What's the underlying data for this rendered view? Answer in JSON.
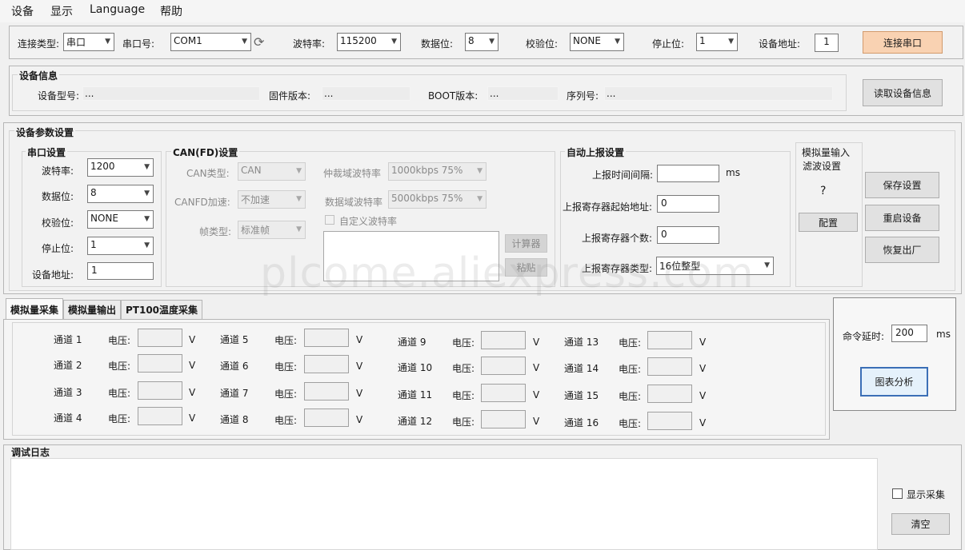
{
  "menu": [
    "设备",
    "显示",
    "Language",
    "帮助"
  ],
  "connection": {
    "type_label": "连接类型:",
    "type_value": "串口",
    "port_label": "串口号:",
    "port_value": "COM1",
    "baud_label": "波特率:",
    "baud_value": "115200",
    "databits_label": "数据位:",
    "databits_value": "8",
    "parity_label": "校验位:",
    "parity_value": "NONE",
    "stopbits_label": "停止位:",
    "stopbits_value": "1",
    "address_label": "设备地址:",
    "address_value": "1",
    "connect_button": "连接串口"
  },
  "device_info": {
    "title": "设备信息",
    "model_label": "设备型号:",
    "model_value": "...",
    "firmware_label": "固件版本:",
    "firmware_value": "...",
    "boot_label": "BOOT版本:",
    "boot_value": "...",
    "serial_label": "序列号:",
    "serial_value": "...",
    "read_button": "读取设备信息"
  },
  "params": {
    "title": "设备参数设置",
    "serial": {
      "title": "串口设置",
      "baud_label": "波特率:",
      "baud_value": "1200",
      "databits_label": "数据位:",
      "databits_value": "8",
      "parity_label": "校验位:",
      "parity_value": "NONE",
      "stopbits_label": "停止位:",
      "stopbits_value": "1",
      "address_label": "设备地址:",
      "address_value": "1"
    },
    "can": {
      "title": "CAN(FD)设置",
      "type_label": "CAN类型:",
      "type_value": "CAN",
      "fd_label": "CANFD加速:",
      "fd_value": "不加速",
      "frame_label": "帧类型:",
      "frame_value": "标准帧",
      "arb_label": "仲裁域波特率",
      "arb_value": "1000kbps 75%",
      "data_label": "数据域波特率",
      "data_value": "5000kbps 75%",
      "custom_label": "自定义波特率",
      "calc_button": "计算器",
      "paste_button": "粘贴"
    },
    "report": {
      "title": "自动上报设置",
      "interval_label": "上报时间间隔:",
      "interval_value": "",
      "interval_unit": "ms",
      "start_label": "上报寄存器起始地址:",
      "start_value": "0",
      "count_label": "上报寄存器个数:",
      "count_value": "0",
      "type_label": "上报寄存器类型:",
      "type_value": "16位整型"
    },
    "filter": {
      "title_line1": "模拟量输入",
      "title_line2": "滤波设置",
      "value": "?",
      "config_button": "配置"
    },
    "save_button": "保存设置",
    "restart_button": "重启设备",
    "factory_button": "恢复出厂"
  },
  "tabs": [
    "模拟量采集",
    "模拟量输出",
    "PT100温度采集"
  ],
  "channels": {
    "voltage_label": "电压:",
    "unit": "V",
    "list": [
      {
        "name": "通道 1",
        "value": ""
      },
      {
        "name": "通道 2",
        "value": ""
      },
      {
        "name": "通道 3",
        "value": ""
      },
      {
        "name": "通道 4",
        "value": ""
      },
      {
        "name": "通道 5",
        "value": ""
      },
      {
        "name": "通道 6",
        "value": ""
      },
      {
        "name": "通道 7",
        "value": ""
      },
      {
        "name": "通道 8",
        "value": ""
      },
      {
        "name": "通道 9",
        "value": ""
      },
      {
        "name": "通道 10",
        "value": ""
      },
      {
        "name": "通道 11",
        "value": ""
      },
      {
        "name": "通道 12",
        "value": ""
      },
      {
        "name": "通道 13",
        "value": ""
      },
      {
        "name": "通道 14",
        "value": ""
      },
      {
        "name": "通道 15",
        "value": ""
      },
      {
        "name": "通道 16",
        "value": ""
      }
    ]
  },
  "command": {
    "delay_label": "命令延时:",
    "delay_value": "200",
    "delay_unit": "ms",
    "chart_button": "图表分析"
  },
  "log": {
    "title": "调试日志",
    "content": "",
    "show_collect_label": "显示采集",
    "clear_button": "清空"
  },
  "watermark": "plcome.aliexpress.com",
  "icons": {
    "refresh": "refresh-icon",
    "dropdown": "chevron-down-icon"
  }
}
